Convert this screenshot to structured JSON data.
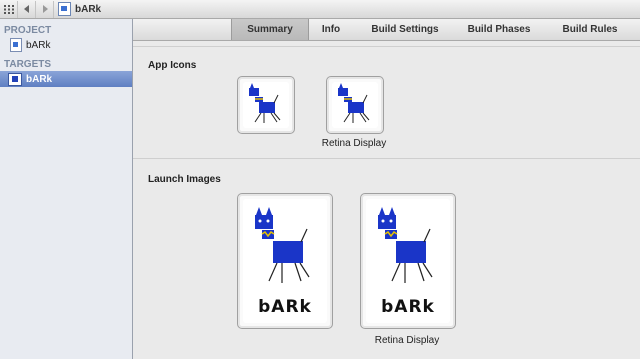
{
  "jumpbar": {
    "title": "bARk"
  },
  "sidebar": {
    "project_header": "PROJECT",
    "project_item": "bARk",
    "targets_header": "TARGETS",
    "target_item": "bARk"
  },
  "tabs": [
    "Summary",
    "Info",
    "Build Settings",
    "Build Phases",
    "Build Rules"
  ],
  "app_icons": {
    "label": "App Icons",
    "retina_caption": "Retina Display"
  },
  "launch_images": {
    "label": "Launch Images",
    "retina_caption": "Retina Display",
    "logo_text": "bARk"
  },
  "colors": {
    "dog_body": "#1a35c8",
    "selection": "#6f8bc9"
  },
  "icons": [
    "grid-icon",
    "back-arrow-icon",
    "forward-arrow-icon",
    "project-file-icon",
    "app-target-icon"
  ]
}
